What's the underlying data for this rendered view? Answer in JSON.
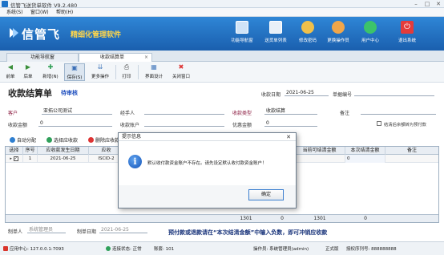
{
  "window": {
    "title": "信管飞送货单软件 V9.2.480",
    "minimize": "–",
    "maximize": "□",
    "close": "✕"
  },
  "menu": [
    "系统(S)",
    "窗口(W)",
    "帮助(H)"
  ],
  "banner": {
    "brand": "信管飞",
    "tagline": "精细化管理软件",
    "buttons": [
      {
        "label": "功能导航窗",
        "icon": "monitor-icon",
        "color": "#cfe3f7"
      },
      {
        "label": "送货单列表",
        "icon": "list-icon",
        "color": "#e8f0f8"
      },
      {
        "label": "修改密码",
        "icon": "key-user-icon",
        "color": "#f0c04a"
      },
      {
        "label": "更换操作员",
        "icon": "user-switch-icon",
        "color": "#f0a64a"
      },
      {
        "label": "用户中心",
        "icon": "globe-icon",
        "color": "#3cc36a"
      },
      {
        "label": "退出系统",
        "icon": "power-icon",
        "color": "#e33b3b"
      }
    ]
  },
  "tabs": [
    {
      "label": "功能导航窗",
      "active": false
    },
    {
      "label": "收款结算单",
      "active": true,
      "close": "×"
    }
  ],
  "toolbar": [
    {
      "label": "前单",
      "icon": "arrow-left-icon",
      "glyph": "◀",
      "color": "#3a8f3a"
    },
    {
      "label": "后单",
      "icon": "arrow-right-icon",
      "glyph": "▶",
      "color": "#3a8f3a"
    },
    {
      "label": "新增(N)",
      "icon": "add-icon",
      "glyph": "✚",
      "color": "#2f9f55"
    },
    {
      "label": "保存(S)",
      "icon": "save-icon",
      "glyph": "▣",
      "color": "#3b6fb6"
    },
    {
      "label": "更多操作",
      "icon": "more-icon",
      "glyph": "⇊",
      "color": "#4d7fbf"
    },
    {
      "label": "打印",
      "icon": "print-icon",
      "glyph": "⎙",
      "color": "#555"
    },
    {
      "label": "界面设计",
      "icon": "design-icon",
      "glyph": "▦",
      "color": "#4d7fbf"
    },
    {
      "label": "关闭窗口",
      "icon": "close-window-icon",
      "glyph": "✖",
      "color": "#d33"
    }
  ],
  "form": {
    "title": "收款结算单",
    "status": "待审核",
    "date_label": "收款日期",
    "date_value": "2021-06-25",
    "billno_label": "单据编号",
    "billno_value": "",
    "customer_label": "客户",
    "customer_value": "亚拓公司测试",
    "handler_label": "经手人",
    "handler_value": "",
    "type_label": "收款类型",
    "type_value": "收款结算",
    "note_label": "备注",
    "note_value": "",
    "amount_label": "收款金额",
    "amount_value": "0",
    "account_label": "收款账户",
    "account_value": "",
    "discount_label": "优惠金额",
    "discount_value": "0",
    "checkbox_label": "结清后余额转为预付款"
  },
  "actions": [
    {
      "label": "自动分配",
      "icon": "auto-assign-icon",
      "color": "#2f7fd0"
    },
    {
      "label": "选择应收款",
      "icon": "select-receivable-icon",
      "color": "#2fa05a"
    },
    {
      "label": "删除应收款",
      "icon": "delete-receivable-icon",
      "color": "#d33"
    }
  ],
  "grid": {
    "headers": [
      "选择",
      "序号",
      "应收款发生日期",
      "应收",
      "当前可结清金额",
      "本次结清金额",
      "备注"
    ],
    "row": {
      "selected": "✓",
      "seq": "1",
      "date": "2021-06-25",
      "code": "ISCID-2",
      "payable": "1301",
      "current": "0",
      "note": ""
    },
    "footer": {
      "a": "1301",
      "b": "0",
      "c": "1301",
      "d": "0"
    }
  },
  "bottom": {
    "maker_label": "制单人",
    "maker_value": "系统管理员",
    "make_date_label": "制单日期",
    "make_date_value": "2021-06-25",
    "hint": "预付款或退款请在“本次结清金额”中输入负数，即可冲销应收款"
  },
  "statusbar": {
    "server": "应用中心: 127.0.0.1:7093",
    "connection": "连接状态: 正常",
    "account": "账套: 101",
    "operator": "操作员: 系统管理员(admin)",
    "edition": "正式版",
    "license": "授权序列号: 888888888"
  },
  "dialog": {
    "title": "提示信息",
    "close": "✕",
    "icon_glyph": "i",
    "message": "默认收付款资金账户不存在。请先设定默认收付款资金账户！",
    "ok": "确定"
  }
}
